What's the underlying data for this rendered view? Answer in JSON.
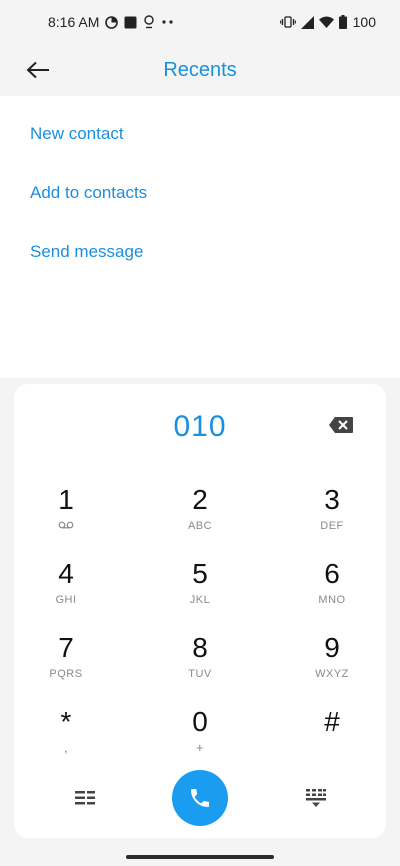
{
  "status_bar": {
    "time": "8:16 AM",
    "battery_level": "100",
    "left_icons": [
      "data-saver-icon",
      "square-notification-icon",
      "location-pin-icon",
      "more-dots-icon"
    ],
    "right_icons": [
      "vibrate-icon",
      "cellular-signal-icon",
      "wifi-icon",
      "battery-icon"
    ]
  },
  "header": {
    "title": "Recents",
    "back_icon": "arrow-left-icon"
  },
  "actions": [
    {
      "label": "New contact"
    },
    {
      "label": "Add to contacts"
    },
    {
      "label": "Send message"
    }
  ],
  "dialpad": {
    "number": "010",
    "backspace_icon": "backspace-icon",
    "keys": [
      {
        "digit": "1",
        "sub": ""
      },
      {
        "digit": "2",
        "sub": "ABC"
      },
      {
        "digit": "3",
        "sub": "DEF"
      },
      {
        "digit": "4",
        "sub": "GHI"
      },
      {
        "digit": "5",
        "sub": "JKL"
      },
      {
        "digit": "6",
        "sub": "MNO"
      },
      {
        "digit": "7",
        "sub": "PQRS"
      },
      {
        "digit": "8",
        "sub": "TUV"
      },
      {
        "digit": "9",
        "sub": "WXYZ"
      },
      {
        "digit": "*",
        "sub": ","
      },
      {
        "digit": "0",
        "sub": "+"
      },
      {
        "digit": "#",
        "sub": ""
      }
    ],
    "key1_sub_icon": "voicemail-icon",
    "bottom": {
      "menu_icon": "menu-list-icon",
      "call_icon": "phone-icon",
      "hide_icon": "hide-dialpad-icon"
    }
  },
  "colors": {
    "accent": "#1a8fe0",
    "call_button": "#1a9cf0",
    "background": "#f4f4f4",
    "card": "#ffffff"
  }
}
